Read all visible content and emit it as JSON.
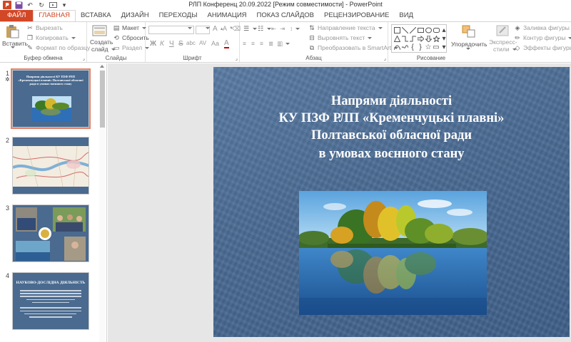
{
  "window": {
    "title": "РЛП Конференц 20.09.2022 [Режим совместимости] - PowerPoint"
  },
  "tabs": [
    {
      "label": "ФАЙЛ"
    },
    {
      "label": "ГЛАВНАЯ"
    },
    {
      "label": "ВСТАВКА"
    },
    {
      "label": "ДИЗАЙН"
    },
    {
      "label": "ПЕРЕХОДЫ"
    },
    {
      "label": "АНИМАЦИЯ"
    },
    {
      "label": "ПОКАЗ СЛАЙДОВ"
    },
    {
      "label": "РЕЦЕНЗИРОВАНИЕ"
    },
    {
      "label": "ВИД"
    }
  ],
  "ribbon": {
    "clipboard": {
      "paste": "Вставить",
      "cut": "Вырезать",
      "copy": "Копировать",
      "format_painter": "Формат по образцу",
      "label": "Буфер обмена"
    },
    "slides": {
      "new_slide_line1": "Создать",
      "new_slide_line2": "слайд",
      "layout": "Макет",
      "reset": "Сбросить",
      "section": "Раздел",
      "label": "Слайды"
    },
    "font": {
      "bold": "Ж",
      "italic": "К",
      "underline": "Ч",
      "strike": "S",
      "shadow": "abc",
      "spacing": "AV",
      "case": "Aa",
      "color": "A",
      "label": "Шрифт"
    },
    "paragraph": {
      "text_direction": "Направление текста",
      "align_text": "Выровнять текст",
      "smartart": "Преобразовать в SmartArt",
      "label": "Абзац"
    },
    "drawing": {
      "arrange": "Упорядочить",
      "quick_styles_line1": "Экспресс-",
      "quick_styles_line2": "стили",
      "shape_fill": "Заливка фигуры",
      "shape_outline": "Контур фигуры",
      "shape_effects": "Эффекты фигуры",
      "label": "Рисование"
    }
  },
  "thumbnails": [
    {
      "number": "1",
      "selected": true,
      "title": "Напрями діяльності КУ ПЗФ РЛП «Кременчуцькі плавні» Полтавської обласної ради в умовах воєнного стану"
    },
    {
      "number": "2",
      "selected": false
    },
    {
      "number": "3",
      "selected": false
    },
    {
      "number": "4",
      "selected": false,
      "title": "НАУКОВО-ДОСЛІДНА ДІЯЛЬНІСТЬ"
    }
  ],
  "slide": {
    "title_lines": [
      "Напрями діяльності",
      "КУ ПЗФ РЛП «Кременчуцькі плавні»",
      "Полтавської обласної ради",
      "в умовах воєнного стану"
    ]
  },
  "colors": {
    "accent": "#d24726",
    "slide_bg": "#4b6b93",
    "selection": "#e2836a"
  }
}
